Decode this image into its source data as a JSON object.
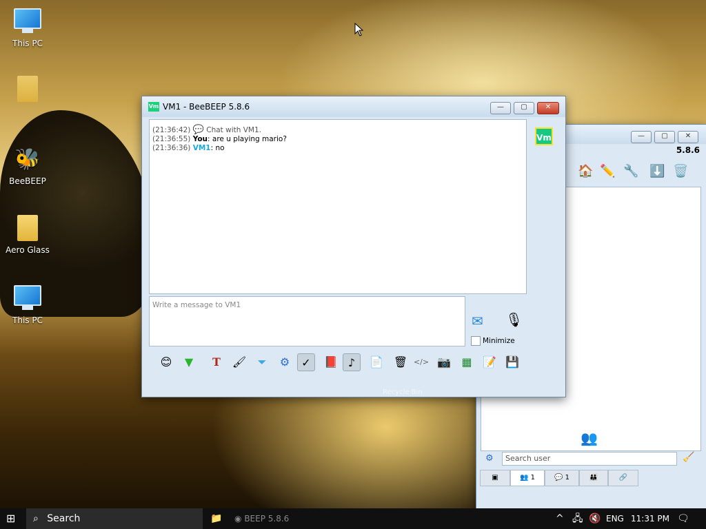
{
  "desktop": {
    "icons": [
      {
        "label": "This PC"
      },
      {
        "label": "BeeBEEP"
      },
      {
        "label": "Aero Glass"
      },
      {
        "label": "This PC"
      }
    ],
    "recycle_bin_label": "Recycle Bin"
  },
  "chat_window": {
    "title": "VM1 - BeeBEEP 5.8.6",
    "app_icon_text": "Vm",
    "avatar_text": "Vm",
    "messages": [
      {
        "time": "(21:36:42)",
        "sender": "",
        "text": "Chat with VM1."
      },
      {
        "time": "(21:36:55)",
        "sender": "You",
        "text": ": are u playing mario?"
      },
      {
        "time": "(21:36:36)",
        "sender": "VM1",
        "text": ": no"
      }
    ],
    "input_placeholder": "Write a message to VM1",
    "minimize_label": "Minimize",
    "colors": {
      "vm1": "#1ca7e0",
      "avatar_bg": "#17c882"
    }
  },
  "side_window": {
    "version": "5.8.6",
    "search_placeholder": "Search user",
    "tabs": [
      {
        "count": "1"
      },
      {
        "count": "1"
      },
      {
        "count": ""
      },
      {
        "count": ""
      },
      {
        "count": ""
      }
    ]
  },
  "taskbar": {
    "search_label": "Search",
    "app_label": "BEEP 5.8.6",
    "language": "ENG",
    "time": "11:31 PM"
  }
}
